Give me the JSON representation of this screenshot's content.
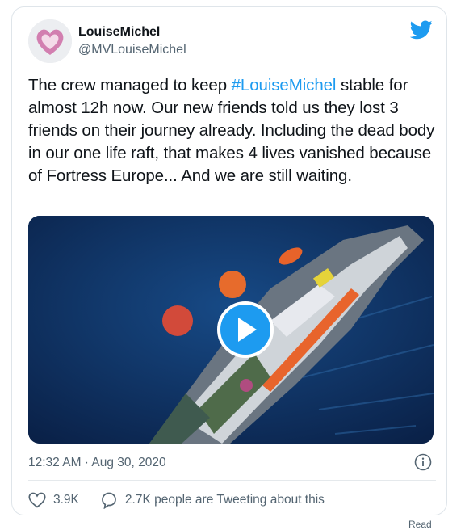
{
  "user": {
    "name": "LouiseMichel",
    "handle": "@MVLouiseMichel"
  },
  "tweet": {
    "text_before": "The crew managed to keep ",
    "hashtag": "#LouiseMichel",
    "text_after": " stable for almost 12h now. Our new friends told us they lost 3 friends on their journey already. Including the dead body in our one life raft, that makes 4 lives vanished because of Fortress Europe... And we are still waiting."
  },
  "timestamp": "12:32 AM · Aug 30, 2020",
  "actions": {
    "likes": "3.9K",
    "tweeting_about": "2.7K people are Tweeting about this"
  },
  "corner_text": "Read",
  "colors": {
    "accent": "#1d9bf0",
    "text": "#0f1419",
    "secondary": "#536471",
    "heart": "#d8a0c0"
  },
  "icons": [
    "twitter-bird-icon",
    "play-icon",
    "info-icon",
    "heart-icon",
    "speech-bubble-icon"
  ]
}
